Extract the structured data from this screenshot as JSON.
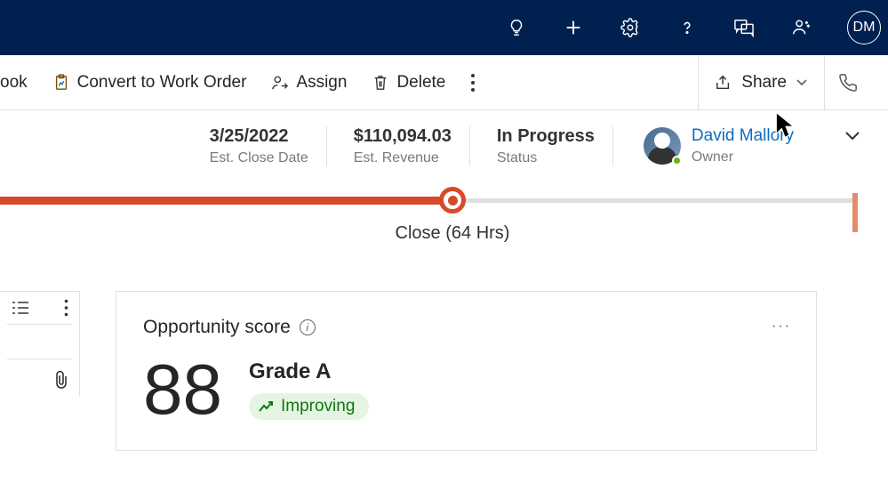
{
  "topbar": {
    "avatar_initials": "DM"
  },
  "commandbar": {
    "book_partial": "ook",
    "convert": "Convert to Work Order",
    "assign": "Assign",
    "delete": "Delete",
    "share": "Share"
  },
  "header": {
    "close_date": {
      "value": "3/25/2022",
      "label": "Est. Close Date"
    },
    "revenue": {
      "value": "$110,094.03",
      "label": "Est. Revenue"
    },
    "status": {
      "value": "In Progress",
      "label": "Status"
    },
    "owner": {
      "name": "David Mallory",
      "label": "Owner"
    }
  },
  "stage": {
    "label": "Close  (64 Hrs)"
  },
  "score_card": {
    "title": "Opportunity score",
    "score": "88",
    "grade": "Grade A",
    "trend": "Improving"
  }
}
